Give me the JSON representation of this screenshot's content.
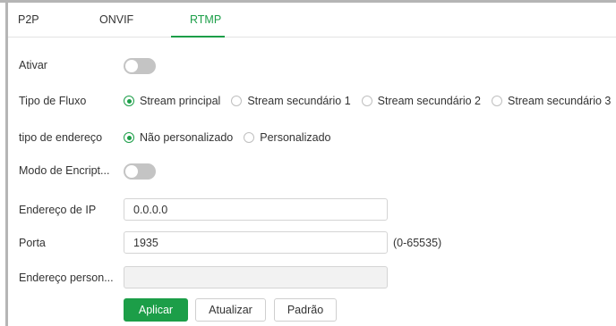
{
  "tabs": [
    {
      "label": "P2P",
      "active": false
    },
    {
      "label": "ONVIF",
      "active": false
    },
    {
      "label": "RTMP",
      "active": true
    }
  ],
  "form": {
    "enable": {
      "label": "Ativar",
      "state": "off"
    },
    "stream_type": {
      "label": "Tipo de Fluxo",
      "options": [
        "Stream principal",
        "Stream secundário 1",
        "Stream secundário 2",
        "Stream secundário 3"
      ],
      "selected": "Stream principal"
    },
    "address_type": {
      "label": "tipo de endereço",
      "options": [
        "Não personalizado",
        "Personalizado"
      ],
      "selected": "Não personalizado"
    },
    "encryption": {
      "label": "Modo de Encript...",
      "state": "off"
    },
    "ip_address": {
      "label": "Endereço de IP",
      "value": "0.0.0.0"
    },
    "port": {
      "label": "Porta",
      "value": "1935",
      "hint": "(0-65535)"
    },
    "custom_address": {
      "label": "Endereço person...",
      "value": ""
    }
  },
  "buttons": {
    "apply": "Aplicar",
    "refresh": "Atualizar",
    "default": "Padrão"
  },
  "colors": {
    "accent": "#1c9e48",
    "toggle_off": "#c4c4c4",
    "frame": "#b5b5b5"
  }
}
